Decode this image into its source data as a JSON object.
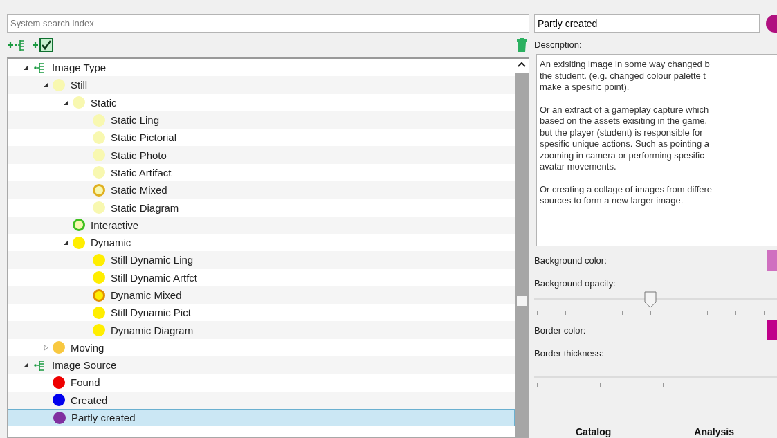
{
  "search": {
    "placeholder": "System search index"
  },
  "tree": [
    {
      "label": "Image Type",
      "kind": "category",
      "expanded": true,
      "selected": false,
      "children": [
        {
          "label": "Still",
          "kind": "tag",
          "color": "#f8f8b0",
          "expanded": true,
          "selected": false,
          "children": [
            {
              "label": "Static",
              "kind": "tag",
              "color": "#f8f8b0",
              "expanded": true,
              "selected": false,
              "children": [
                {
                  "label": "Static Ling",
                  "kind": "tag",
                  "color": "#f8f8b0",
                  "selected": false
                },
                {
                  "label": "Static Pictorial",
                  "kind": "tag",
                  "color": "#f8f8b0",
                  "selected": false
                },
                {
                  "label": "Static Photo",
                  "kind": "tag",
                  "color": "#f8f8b0",
                  "selected": false
                },
                {
                  "label": "Static Artifact",
                  "kind": "tag",
                  "color": "#f8f8b0",
                  "selected": false
                },
                {
                  "label": "Static Mixed",
                  "kind": "tag",
                  "color": "#f8f8b0",
                  "ring": {
                    "color": "#e0b020"
                  },
                  "selected": false
                },
                {
                  "label": "Static Diagram",
                  "kind": "tag",
                  "color": "#f8f8b0",
                  "selected": false
                }
              ]
            },
            {
              "label": "Interactive",
              "kind": "tag",
              "color": "#f8f8b0",
              "ring": {
                "color": "#40c020"
              },
              "selected": false
            },
            {
              "label": "Dynamic",
              "kind": "tag",
              "color": "#ffee00",
              "expanded": true,
              "selected": false,
              "children": [
                {
                  "label": "Still Dynamic Ling",
                  "kind": "tag",
                  "color": "#ffee00",
                  "selected": false
                },
                {
                  "label": "Still Dynamic Artfct",
                  "kind": "tag",
                  "color": "#ffee00",
                  "selected": false
                },
                {
                  "label": "Dynamic Mixed",
                  "kind": "tag",
                  "color": "#ffee00",
                  "ring": {
                    "color": "#e09000"
                  },
                  "selected": false
                },
                {
                  "label": "Still Dynamic Pict",
                  "kind": "tag",
                  "color": "#ffee00",
                  "selected": false
                },
                {
                  "label": "Dynamic Diagram",
                  "kind": "tag",
                  "color": "#ffee00",
                  "selected": false
                }
              ]
            }
          ]
        },
        {
          "label": "Moving",
          "kind": "tag",
          "color": "#f8c840",
          "expanded": false,
          "selected": false
        }
      ]
    },
    {
      "label": "Image Source",
      "kind": "category",
      "expanded": true,
      "selected": false,
      "children": [
        {
          "label": "Found",
          "kind": "tag",
          "color": "#ee0000",
          "selected": false
        },
        {
          "label": "Created",
          "kind": "tag",
          "color": "#0000ee",
          "selected": false
        },
        {
          "label": "Partly created",
          "kind": "tag",
          "color": "#8030a0",
          "selected": true
        }
      ]
    }
  ],
  "details": {
    "name": "Partly created",
    "tag": {
      "color": "#b0107f"
    },
    "description_label": "Description:",
    "description": [
      [
        "An exisiting image in some way changed b",
        "the student. (e.g. changed colour palette t",
        "make a spesific point)."
      ],
      [
        "Or an extract of a gameplay capture which",
        "based on the assets exisiting in the game,",
        "but the player (student) is responsible for",
        "spesific unique actions. Such as pointing a",
        "zooming in camera or performing spesific",
        "avatar movements."
      ],
      [
        "Or creating a collage of images from differe",
        "sources to form a new larger image."
      ]
    ],
    "background_color": {
      "label": "Background color:",
      "color": "#d070c0"
    },
    "background_opacity": {
      "label": "Background opacity:",
      "level": 0.48
    },
    "border_color": {
      "label": "Border color:",
      "color": "#c0008a"
    },
    "border_thickness": {
      "label": "Border thickness:"
    }
  },
  "tabs": [
    {
      "label": "Catalog"
    },
    {
      "label": "Analysis"
    }
  ]
}
